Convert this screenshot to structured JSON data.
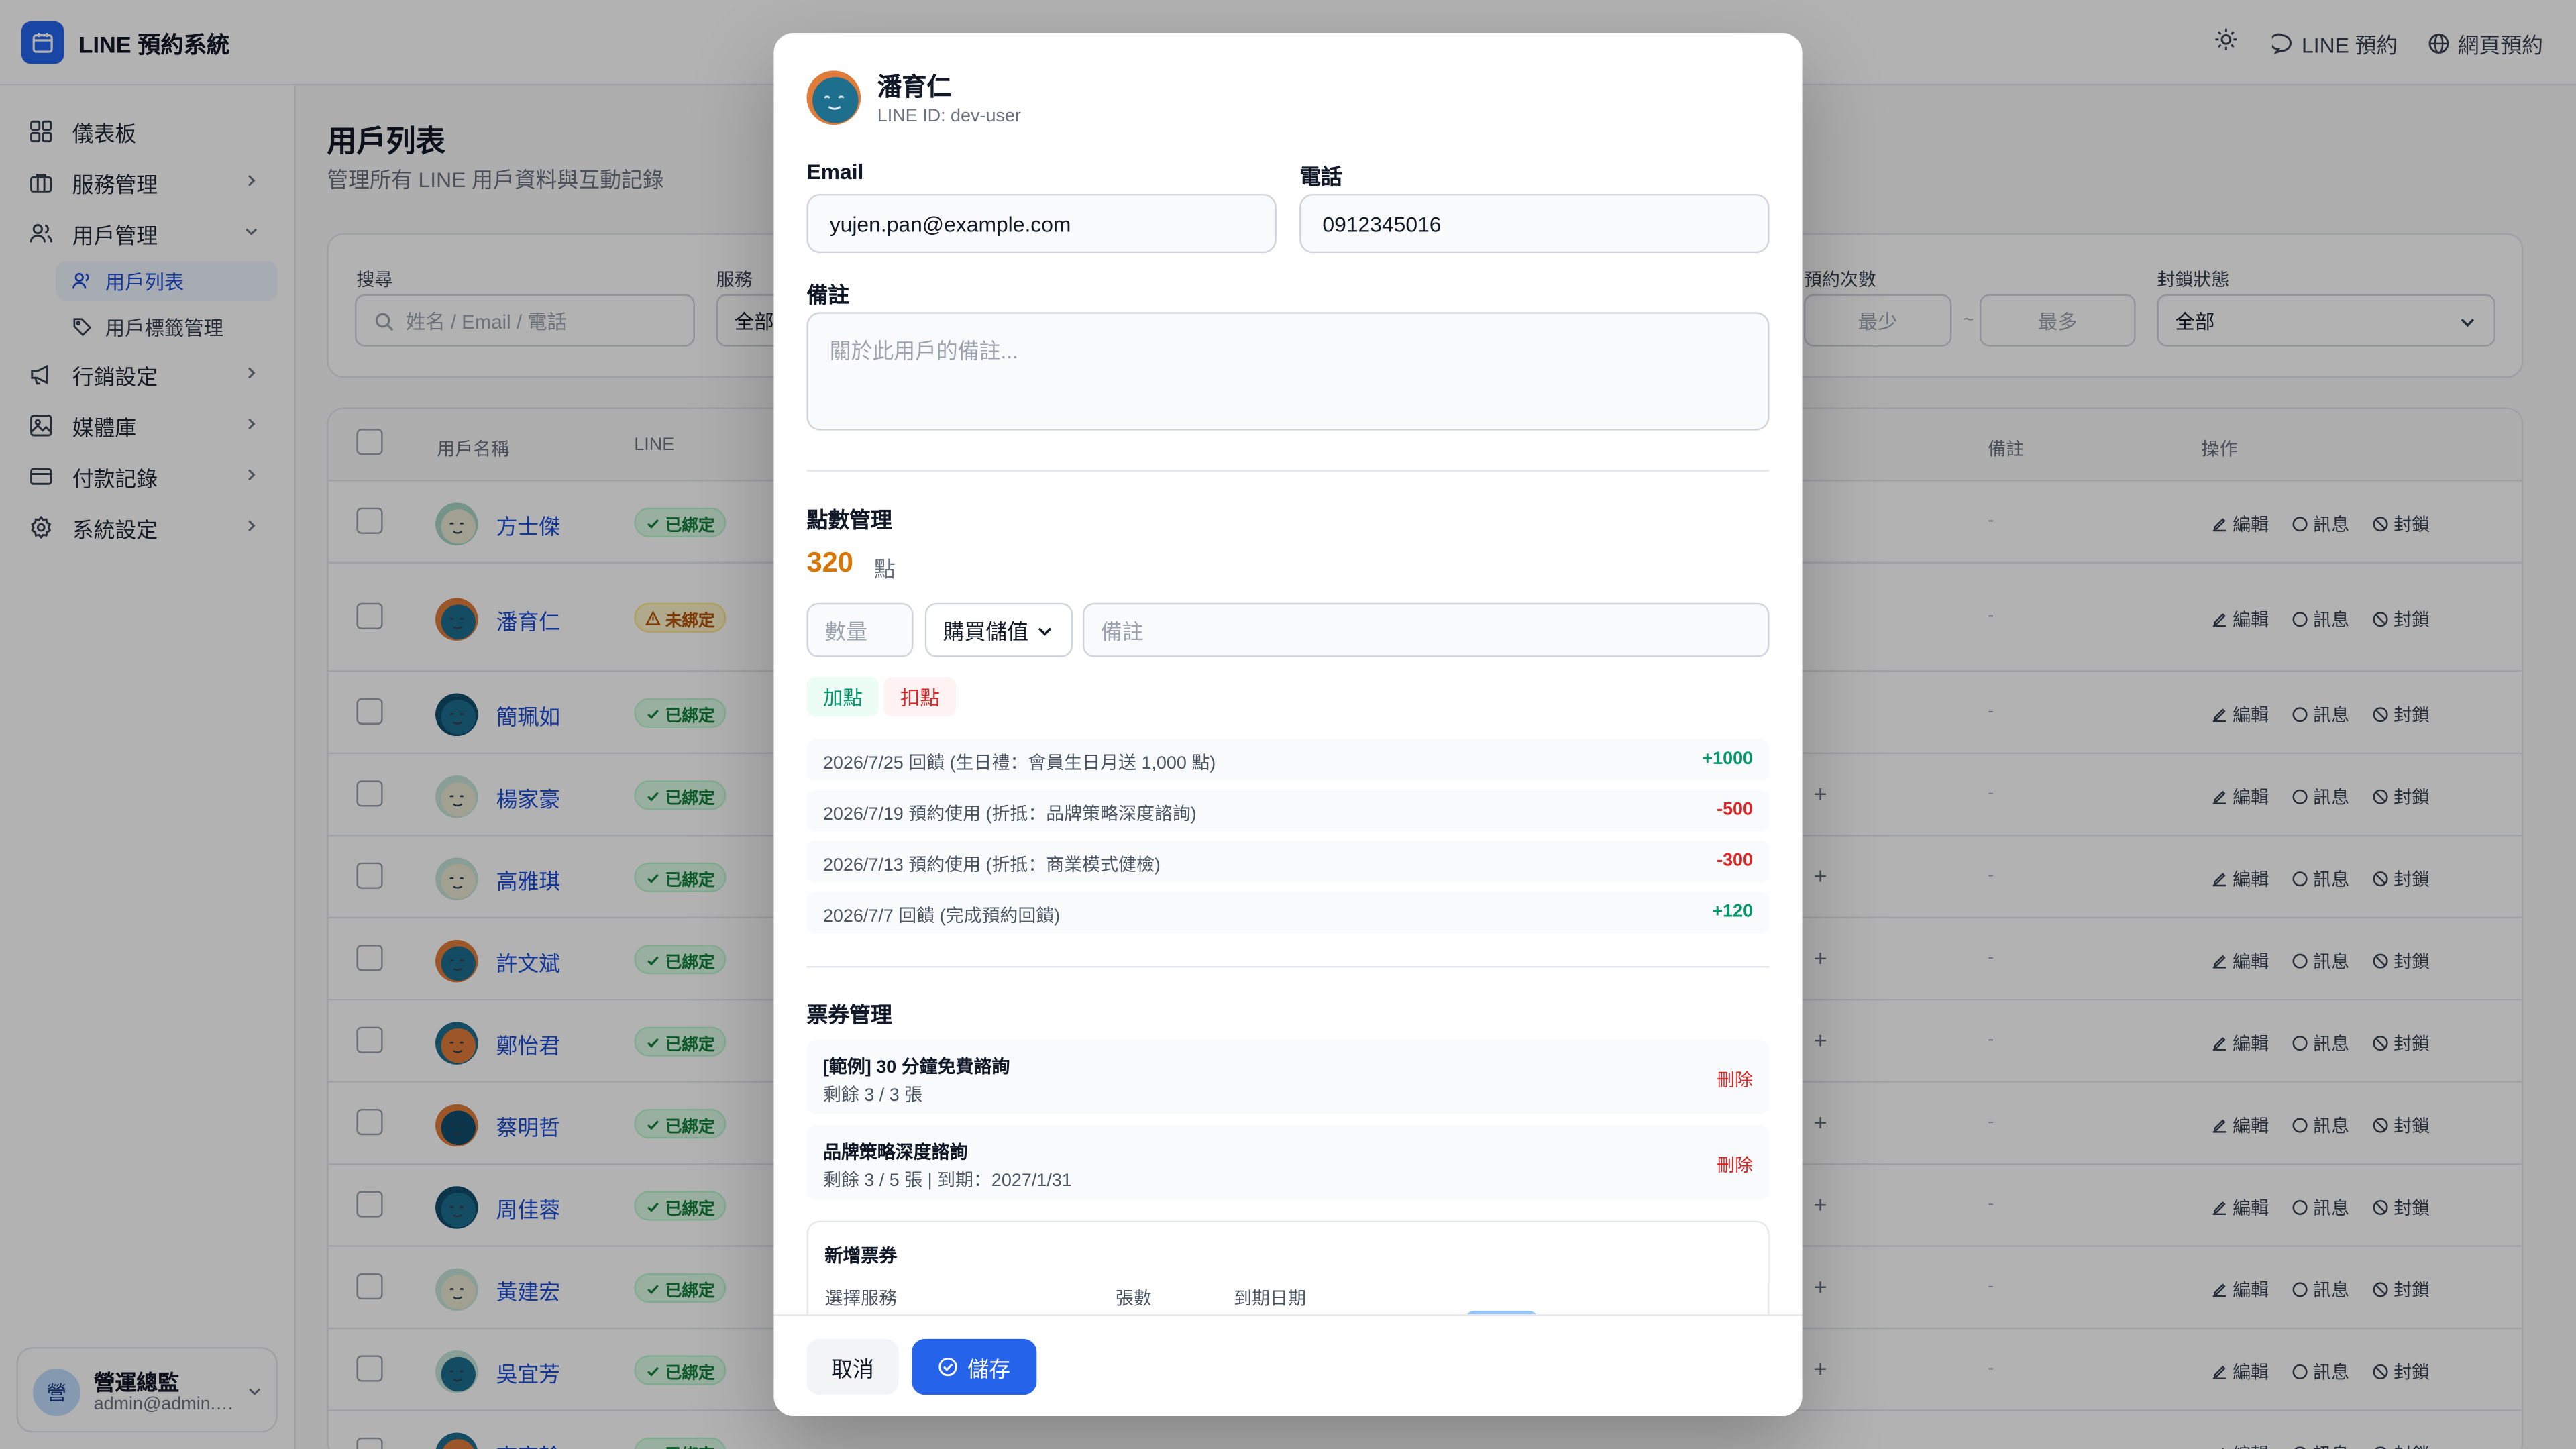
{
  "app": {
    "title": "LINE 預約系統"
  },
  "topbar": {
    "line_booking": "LINE 預約",
    "web_booking": "網頁預約"
  },
  "sidebar": {
    "items": [
      {
        "label": "儀表板"
      },
      {
        "label": "服務管理"
      },
      {
        "label": "用戶管理"
      },
      {
        "label": "行銷設定"
      },
      {
        "label": "媒體庫"
      },
      {
        "label": "付款記錄"
      },
      {
        "label": "系統設定"
      }
    ],
    "sub_items": [
      {
        "label": "用戶列表"
      },
      {
        "label": "用戶標籤管理"
      }
    ],
    "user": {
      "avatar": "營",
      "name": "營運總監",
      "email": "admin@admin.com"
    }
  },
  "page": {
    "title": "用戶列表",
    "subtitle": "管理所有 LINE 用戶資料與互動記錄"
  },
  "filters": {
    "search_label": "搜尋",
    "search_placeholder": "姓名 / Email / 電話",
    "service_label": "服務",
    "service_value": "全部",
    "count_label": "預約次數",
    "count_min": "最少",
    "count_sep": "~",
    "count_max": "最多",
    "block_label": "封鎖狀態",
    "block_value": "全部"
  },
  "table": {
    "headers": {
      "name": "用戶名稱",
      "line": "LINE",
      "notes": "備註",
      "actions": "操作"
    },
    "rows": [
      {
        "name": "方士傑",
        "status": "已綁定"
      },
      {
        "name": "潘育仁",
        "status": "未綁定"
      },
      {
        "name": "簡珮如",
        "status": "已綁定"
      },
      {
        "name": "楊家豪",
        "status": "已綁定"
      },
      {
        "name": "高雅琪",
        "status": "已綁定"
      },
      {
        "name": "許文斌",
        "status": "已綁定"
      },
      {
        "name": "鄭怡君",
        "status": "已綁定"
      },
      {
        "name": "蔡明哲",
        "status": "已綁定"
      },
      {
        "name": "周佳蓉",
        "status": "已綁定"
      },
      {
        "name": "黃建宏",
        "status": "已綁定"
      },
      {
        "name": "吳宜芳",
        "status": "已綁定"
      },
      {
        "name": "李宗翰",
        "status": "已綁定"
      }
    ],
    "dash": "-",
    "plus": "+",
    "edit": "編輯",
    "message": "訊息",
    "block": "封鎖"
  },
  "modal": {
    "name": "潘育仁",
    "line_id": "LINE ID: dev-user",
    "email_label": "Email",
    "email_value": "yujen.pan@example.com",
    "phone_label": "電話",
    "phone_value": "0912345016",
    "note_label": "備註",
    "note_placeholder": "關於此用戶的備註...",
    "points_title": "點數管理",
    "points_value": "320",
    "points_unit": "點",
    "qty_placeholder": "數量",
    "type_value": "購買儲值",
    "memo_placeholder": "備註",
    "add_btn": "加點",
    "deduct_btn": "扣點",
    "history": [
      {
        "desc": "2026/7/25  回饋  (生日禮：會員生日月送 1,000 點)",
        "value": "+1000"
      },
      {
        "desc": "2026/7/19  預約使用  (折抵：品牌策略深度諮詢)",
        "value": "-500"
      },
      {
        "desc": "2026/7/13  預約使用  (折抵：商業模式健檢)",
        "value": "-300"
      },
      {
        "desc": "2026/7/7  回饋  (完成預約回饋)",
        "value": "+120"
      }
    ],
    "tickets_title": "票券管理",
    "tickets": [
      {
        "name": "[範例] 30 分鐘免費諮詢",
        "sub": "剩餘 3 / 3 張",
        "delete": "刪除"
      },
      {
        "name": "品牌策略深度諮詢",
        "sub": "剩餘 3 / 5 張 | 到期：2027/1/31",
        "delete": "刪除"
      }
    ],
    "new_ticket": {
      "title": "新增票券",
      "service_label": "選擇服務",
      "qty_label": "張數",
      "expiry_label": "到期日期"
    },
    "cancel": "取消",
    "save": "儲存"
  },
  "colors": {
    "accent": "#2563eb",
    "points": "#d97706",
    "positive": "#059669",
    "negative": "#dc2626"
  }
}
